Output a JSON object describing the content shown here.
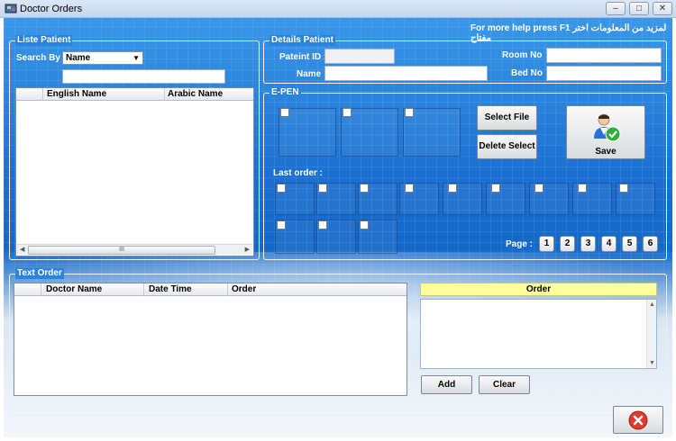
{
  "window": {
    "title": "Doctor Orders",
    "minimize": "–",
    "maximize": "□",
    "close": "✕"
  },
  "help_text": "For more help press F1  لمزيد من المعلومات اختر مفتاح",
  "liste_patient": {
    "legend": "Liste Patient",
    "search_by_label": "Search By :",
    "search_by_value": "Name",
    "search_value": "",
    "columns": [
      "English Name",
      "Arabic Name"
    ]
  },
  "details_patient": {
    "legend": "Details Patient",
    "patient_id_label": "Pateint ID :",
    "name_label": "Name :",
    "room_label": "Room No",
    "bed_label": "Bed No",
    "patient_id_value": "",
    "name_value": "",
    "room_value": "",
    "bed_value": ""
  },
  "epen": {
    "legend": "E-PEN",
    "select_file": "Select File",
    "delete_select": "Delete Select",
    "save": "Save",
    "last_order_label": "Last order :",
    "page_label": "Page :",
    "pages": [
      "1",
      "2",
      "3",
      "4",
      "5",
      "6"
    ]
  },
  "text_order": {
    "legend": "Text Order",
    "columns": [
      "Doctor Name",
      "Date Time",
      "Order"
    ],
    "order_header": "Order",
    "add": "Add",
    "clear": "Clear"
  },
  "colors": {
    "accent": "#1a6fd0",
    "order_header": "#ffff9e",
    "close_red": "#e03a2a"
  }
}
